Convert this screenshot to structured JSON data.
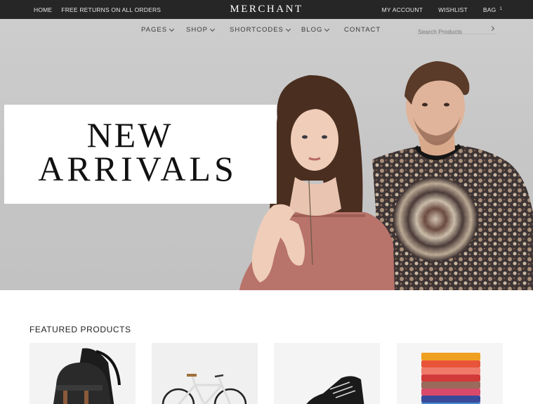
{
  "topbar": {
    "links_left": [
      "HOME",
      "FREE RETURNS ON ALL ORDERS"
    ],
    "logo": "MERCHANT",
    "links_right": [
      "MY ACCOUNT",
      "WISHLIST",
      "BAG"
    ],
    "bag_count": "1"
  },
  "nav": {
    "items": [
      "PAGES",
      "SHOP",
      "SHORTCODES",
      "BLOG",
      "CONTACT"
    ],
    "search_placeholder": "Search Products"
  },
  "hero": {
    "line1": "NEW",
    "line2": "ARRIVALS"
  },
  "featured": {
    "title": "FEATURED PRODUCTS",
    "products": [
      "backpack",
      "bicycle",
      "sneaker",
      "folded-shirts"
    ]
  },
  "colors": {
    "topbar_bg": "#262626",
    "hero_bg": "#c8c8c8",
    "blouse": "#b8736a"
  }
}
